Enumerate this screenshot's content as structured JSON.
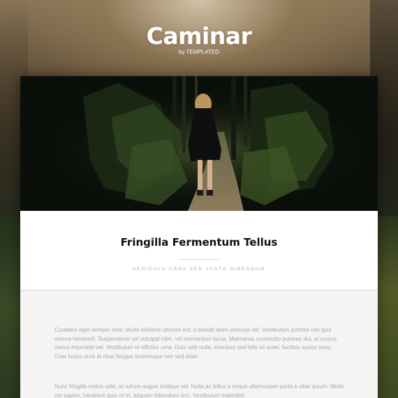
{
  "site": {
    "title": "Caminar",
    "byline": "by TEMPLATED"
  },
  "post": {
    "title": "Fringilla Fermentum Tellus",
    "subtitle": "VEHICULA URNA SED JUSTO BIBENDUM",
    "paragraphs": [
      "Curabitur eget semper ante. Morbi eleifend ultricies est, a blandit diam vehicula vel. Vestibulum porttitor nisi quis viverra hendrerit. Suspendisse vel volutpat nibh, vel elementum lacus. Maecenas commodo pulvinar dui, at cursus metus imperdiet vel. Vestibulum et efficitur urna. Duis velit nulla, interdum sed felis sit amet, facilisis auctor nunc. Cras luctus urna at risus feugiat scelerisque nec sed diam.",
      "Nunc fringilla metus odio, at rutrum augue tristique vel. Nulla ac tellus a neque ullamcorper porta a vitae ipsum. Morbi est sapien, hendrerit quis mi in, aliquam bibendum orci. Vestibulum imperdiet"
    ]
  },
  "colors": {
    "card_background": "#ffffff",
    "body_background": "#f4f4f2",
    "title_text": "#111111",
    "paragraph_text": "#a8a8a8"
  }
}
